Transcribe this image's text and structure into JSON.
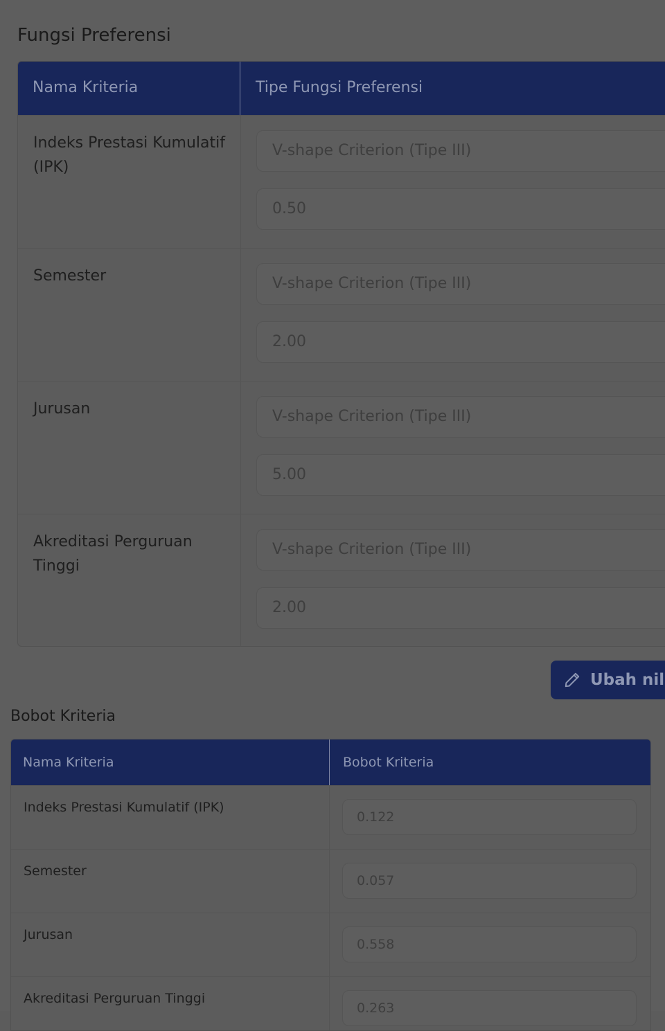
{
  "fungsi_preferensi": {
    "title": "Fungsi Preferensi",
    "headers": {
      "name": "Nama Kriteria",
      "type": "Tipe Fungsi Preferensi"
    },
    "rows": [
      {
        "name": "Indeks Prestasi Kumulatif (IPK)",
        "type": "V-shape Criterion (Tipe III)",
        "value": "0.50"
      },
      {
        "name": "Semester",
        "type": "V-shape Criterion (Tipe III)",
        "value": "2.00"
      },
      {
        "name": "Jurusan",
        "type": "V-shape Criterion (Tipe III)",
        "value": "5.00"
      },
      {
        "name": "Akreditasi Perguruan Tinggi",
        "type": "V-shape Criterion (Tipe III)",
        "value": "2.00"
      }
    ],
    "edit_button_label": "Ubah nilai"
  },
  "bobot_kriteria": {
    "title": "Bobot Kriteria",
    "headers": {
      "name": "Nama Kriteria",
      "weight": "Bobot Kriteria"
    },
    "rows": [
      {
        "name": "Indeks Prestasi Kumulatif (IPK)",
        "weight": "0.122"
      },
      {
        "name": "Semester",
        "weight": "0.057"
      },
      {
        "name": "Jurusan",
        "weight": "0.558"
      },
      {
        "name": "Akreditasi Perguruan Tinggi",
        "weight": "0.263"
      }
    ]
  },
  "icons": {
    "edit": "pencil-icon"
  },
  "colors": {
    "header_bg": "#18265a",
    "overlay_page": "#5e5e5e"
  }
}
